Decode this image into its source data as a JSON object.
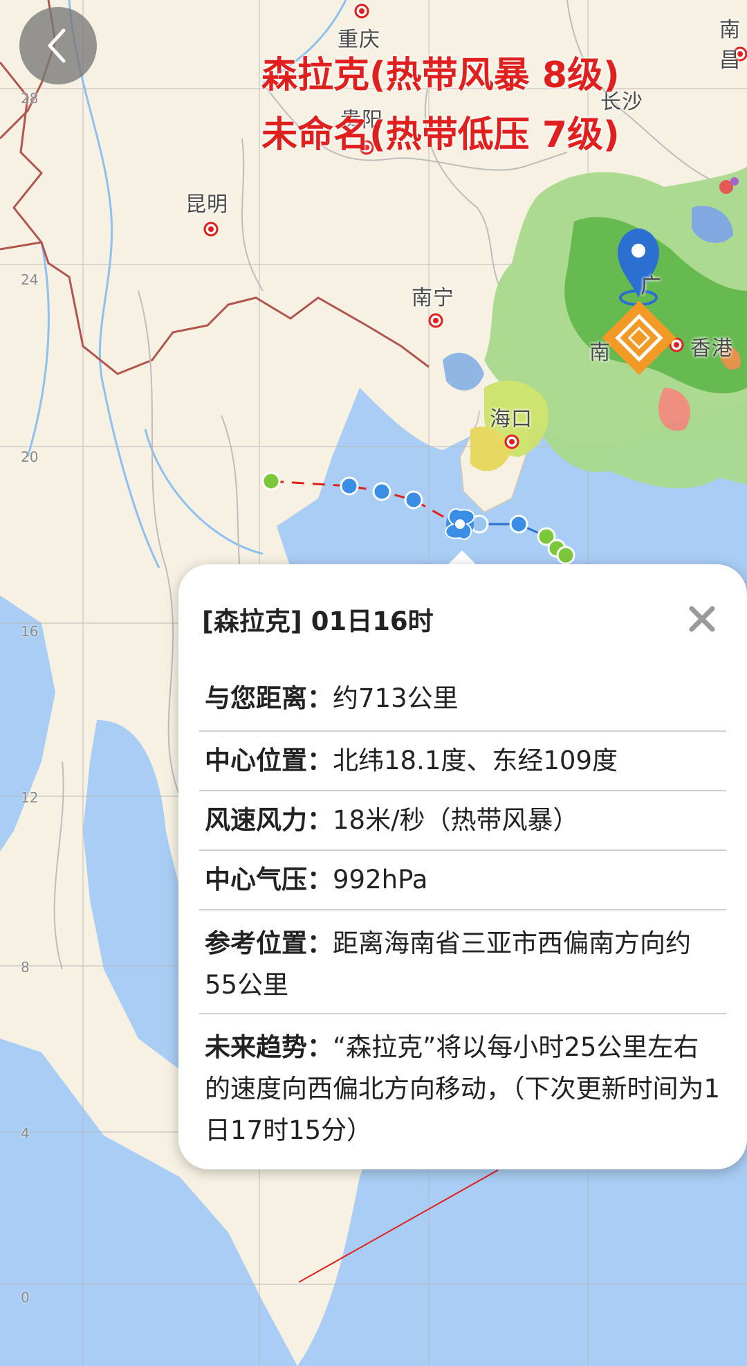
{
  "header": {
    "back_icon": "chevron-left-icon",
    "title_line_1": "森拉克(热带风暴 8级)",
    "title_line_2": "未命名(热带低压 7级)"
  },
  "map": {
    "cities": {
      "chongqing": "重庆",
      "guiyang": "贵阳",
      "changsha": "长沙",
      "kunming": "昆明",
      "nanning": "南宁",
      "haikou": "海口",
      "hongkong": "香港",
      "nanchang": "南昌",
      "guangzhou": "广",
      "nan": "南"
    },
    "latitude_labels": [
      "28",
      "24",
      "20",
      "16",
      "12",
      "8",
      "4",
      "0"
    ],
    "location_pin_icon": "map-pin-icon",
    "typhoon_icon": "typhoon-icon",
    "colors": {
      "title_red": "#e0201f",
      "track_blue": "#3a8ee6",
      "forecast_green": "#7cc83a",
      "sea": "#a9cdf4",
      "land": "#f6f1e3"
    }
  },
  "popup": {
    "title": "[森拉克] 01日16时",
    "close_icon": "close-icon",
    "rows": [
      {
        "label": "与您距离：",
        "value": "约713公里"
      },
      {
        "label": "中心位置：",
        "value": "北纬18.1度、东经109度"
      },
      {
        "label": "风速风力：",
        "value": "18米/秒（热带风暴）"
      },
      {
        "label": "中心气压：",
        "value": "992hPa"
      },
      {
        "label": "参考位置：",
        "value": "距离海南省三亚市西偏南方向约55公里"
      },
      {
        "label": "未来趋势：",
        "value": "“森拉克”将以每小时25公里左右的速度向西偏北方向移动，（下次更新时间为1日17时15分）"
      }
    ]
  }
}
